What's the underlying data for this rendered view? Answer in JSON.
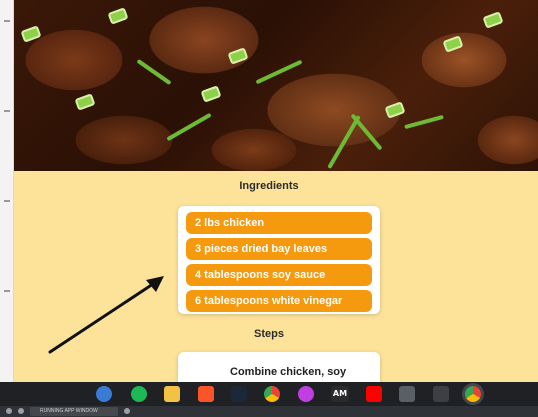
{
  "ingredients": {
    "title": "Ingredients",
    "items": [
      "2 lbs chicken",
      "3 pieces dried bay leaves",
      "4 tablespoons soy sauce",
      "6 tablespoons white vinegar"
    ]
  },
  "steps": {
    "title": "Steps",
    "first_step": "Combine chicken, soy"
  },
  "taskbar": {
    "icons": [
      "clock-app",
      "spotify",
      "file-explorer",
      "brave",
      "steam",
      "chrome",
      "picsart",
      "am-app",
      "youtube",
      "calculator",
      "game-app",
      "chrome-active"
    ],
    "am_label": "AM"
  },
  "statusbar": {
    "tab_label": "RUNNING APP WINDOW"
  },
  "colors": {
    "page_bg": "#fde29a",
    "ingredient_bg": "#f5990f",
    "ingredient_text": "#ffffff",
    "taskbar_bg": "#1f2124"
  }
}
